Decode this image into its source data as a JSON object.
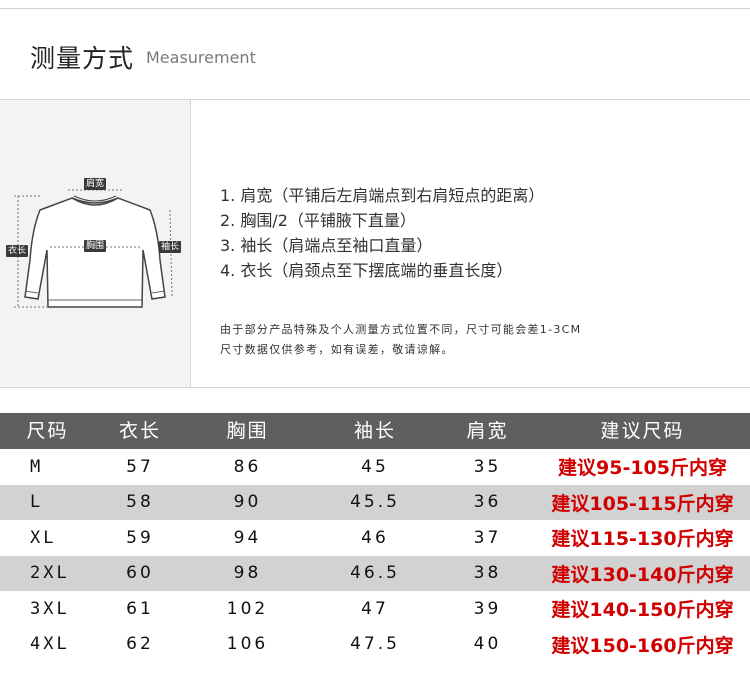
{
  "header": {
    "title_cn": "测量方式",
    "title_en": "Measurement"
  },
  "diagram": {
    "labels": {
      "shoulder": "肩宽",
      "chest": "胸围",
      "sleeve": "袖长",
      "length": "衣长"
    }
  },
  "instructions": {
    "steps": [
      "1. 肩宽（平铺后左肩端点到右肩短点的距离）",
      "2. 胸围/2（平铺腋下直量）",
      "3. 袖长（肩端点至袖口直量）",
      "4. 衣长（肩颈点至下摆底端的垂直长度）"
    ],
    "note_lines": [
      "由于部分产品特殊及个人测量方式位置不同，尺寸可能会差1-3CM",
      "尺寸数据仅供参考，如有误差，敬请谅解。"
    ]
  },
  "size_table": {
    "headers": [
      "尺码",
      "衣长",
      "胸围",
      "袖长",
      "肩宽",
      "建议尺码"
    ],
    "rows": [
      [
        "M",
        "57",
        "86",
        "45",
        "35",
        "建议95-105斤内穿"
      ],
      [
        "L",
        "58",
        "90",
        "45.5",
        "36",
        "建议105-115斤内穿"
      ],
      [
        "XL",
        "59",
        "94",
        "46",
        "37",
        "建议115-130斤内穿"
      ],
      [
        "2XL",
        "60",
        "98",
        "46.5",
        "38",
        "建议130-140斤内穿"
      ],
      [
        "3XL",
        "61",
        "102",
        "47",
        "39",
        "建议140-150斤内穿"
      ],
      [
        "4XL",
        "62",
        "106",
        "47.5",
        "40",
        "建议150-160斤内穿"
      ]
    ]
  },
  "colors": {
    "header_bg": "#5f5f5f",
    "alt_row": "#d2d2d2",
    "recommend": "#d10000"
  }
}
